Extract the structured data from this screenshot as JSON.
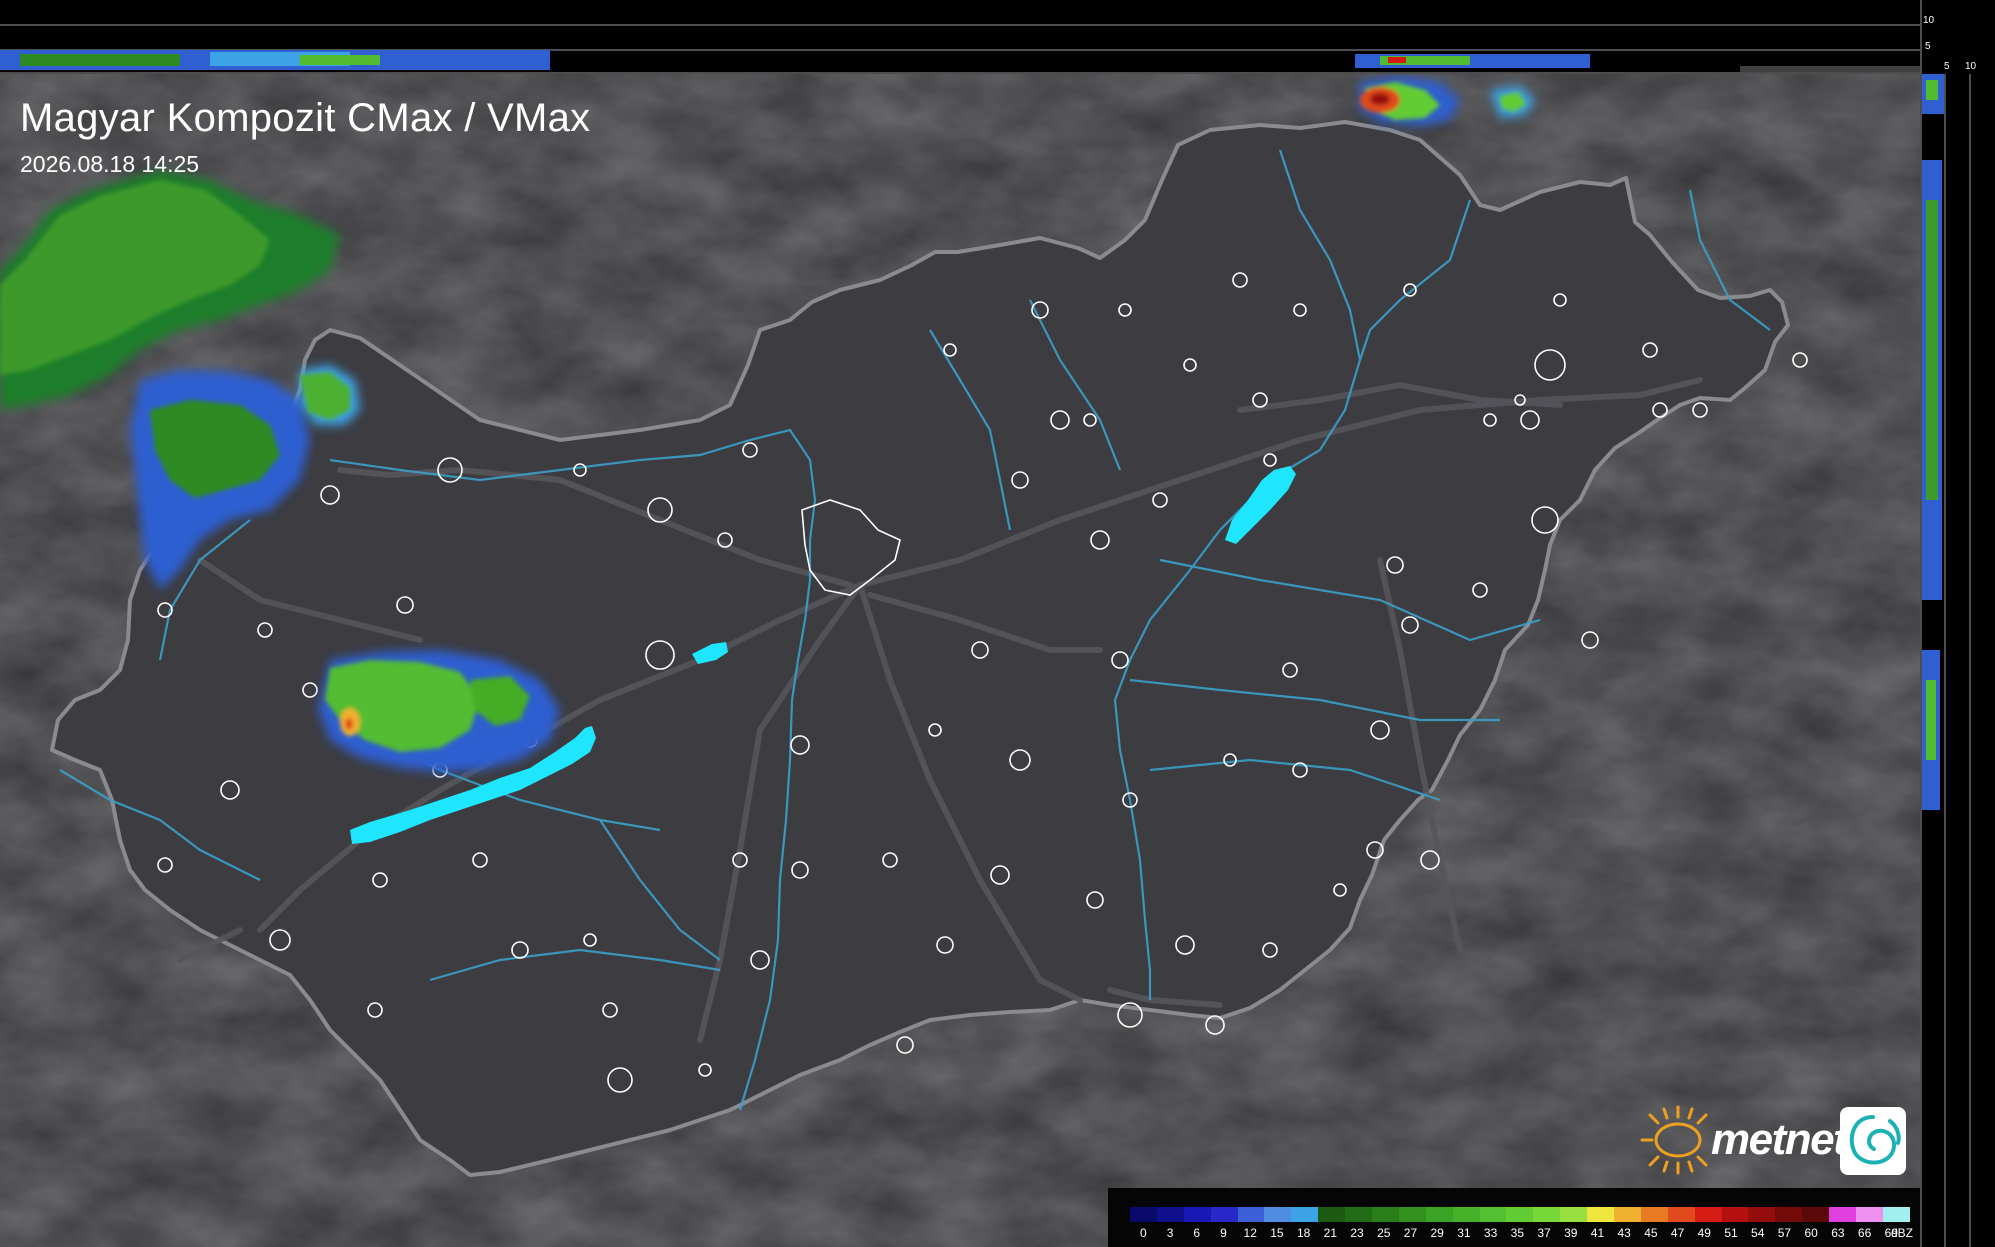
{
  "title": "Magyar Kompozit CMax / VMax",
  "timestamp": "2026.08.18 14:25",
  "brand": {
    "name": "metnet"
  },
  "side_panel_ticks": {
    "top": [
      "10",
      "5"
    ],
    "right": [
      "5",
      "10"
    ]
  },
  "legend": {
    "unit": "dBZ",
    "labels": [
      "0",
      "3",
      "6",
      "9",
      "12",
      "15",
      "18",
      "21",
      "23",
      "25",
      "27",
      "29",
      "31",
      "33",
      "35",
      "37",
      "39",
      "41",
      "43",
      "45",
      "47",
      "49",
      "51",
      "54",
      "57",
      "60",
      "63",
      "66",
      "69"
    ],
    "colors": [
      "#0a0a6a",
      "#10108c",
      "#1818b4",
      "#2828c8",
      "#3a5fd6",
      "#4f8de0",
      "#3ca3e6",
      "#1c5a12",
      "#226c16",
      "#2a7e1a",
      "#31901e",
      "#3aa224",
      "#45b22a",
      "#52c030",
      "#62cc34",
      "#78d83a",
      "#98e040",
      "#f0e640",
      "#f0b030",
      "#e87a24",
      "#e04a1c",
      "#d41c14",
      "#b41010",
      "#940c0c",
      "#740a0a",
      "#5a0808",
      "#e040e0",
      "#f090f0",
      "#a0f0f0"
    ]
  },
  "map": {
    "country": "Hungary",
    "lakes": [
      "Balaton",
      "Velence",
      "Tisza-to"
    ],
    "colors": {
      "background": "#303033",
      "country": "#3c3c41",
      "border": "#8a8a90",
      "river": "#3aa0c8",
      "road": "#5a5a60",
      "town": "#ffffff",
      "lake": "#1ee6ff"
    }
  }
}
